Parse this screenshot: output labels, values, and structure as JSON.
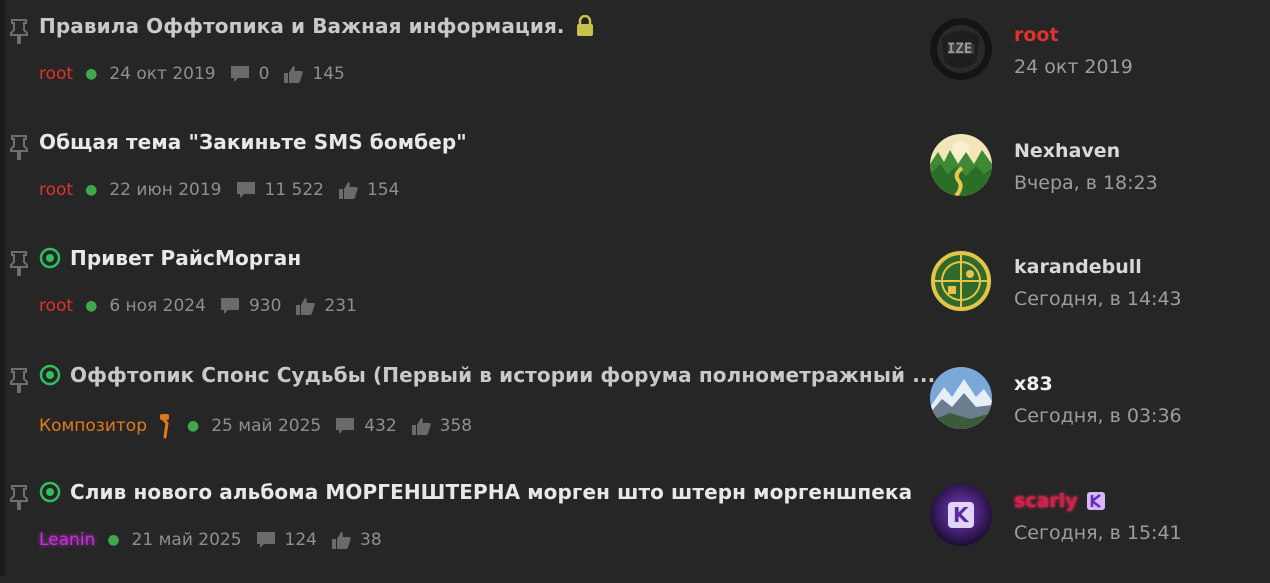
{
  "threads": [
    {
      "title": "Правила Оффтопика и Важная информация.",
      "author": "root",
      "date": "24 окт 2019",
      "replies": "0",
      "likes": "145",
      "last_user": "root",
      "last_time": "24 окт 2019",
      "avatar_text": "IZE"
    },
    {
      "title": "Общая тема \"Закиньте SMS бомбер\"",
      "author": "root",
      "date": "22 июн 2019",
      "replies": "11 522",
      "likes": "154",
      "last_user": "Nexhaven",
      "last_time": "Вчера, в 18:23"
    },
    {
      "title": "Привет РайсМорган",
      "author": "root",
      "date": "6 ноя 2024",
      "replies": "930",
      "likes": "231",
      "last_user": "karandebull",
      "last_time": "Сегодня, в 14:43"
    },
    {
      "title": "Оффтопик Спонс Судьбы (Первый в истории форума полнометражный ...",
      "author": "Композитор",
      "date": "25 май 2025",
      "replies": "432",
      "likes": "358",
      "last_user": "x83",
      "last_time": "Сегодня, в 03:36"
    },
    {
      "title": "Слив нового альбома МОРГЕНШТЕРНА морген што штерн моргеншпека",
      "author": "Leanin",
      "date": "21 май 2025",
      "replies": "124",
      "likes": "38",
      "last_user": "scarly",
      "last_time": "Сегодня, в 15:41",
      "avatar_text": "K"
    }
  ],
  "icons": {
    "pin": "pin-icon",
    "lock": "lock-icon",
    "prefix": "target-icon",
    "replies": "comment-icon",
    "likes": "thumbs-up-icon",
    "microphone": "microphone-icon",
    "badge": "k-badge-icon"
  },
  "colors": {
    "background": "#262626",
    "root_user": "#e0332e",
    "composer_user": "#e07a1c",
    "leanin_user": "#c62fd9",
    "scarly_user": "#d01f4a",
    "dot": "#3fa84f",
    "prefix": "#2fbf5f",
    "lock": "#c8c24a"
  }
}
